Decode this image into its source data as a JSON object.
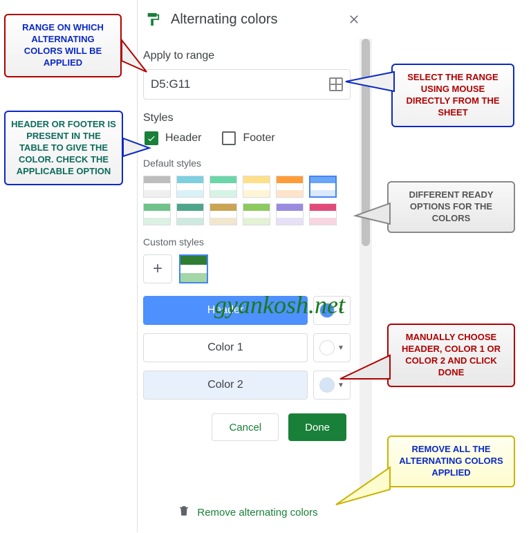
{
  "panel": {
    "title": "Alternating colors",
    "apply_label": "Apply to range",
    "range_value": "D5:G11",
    "styles_label": "Styles",
    "header_label": "Header",
    "footer_label": "Footer",
    "header_checked": true,
    "footer_checked": false,
    "default_styles_label": "Default styles",
    "custom_styles_label": "Custom styles",
    "add_symbol": "+",
    "color_rows": {
      "header": "Header",
      "color1": "Color 1",
      "color2": "Color 2"
    },
    "color_values": {
      "header": "#4d90fe",
      "color1": "#ffffff",
      "color2": "#d6e4f7"
    },
    "buttons": {
      "cancel": "Cancel",
      "done": "Done"
    },
    "remove_label": "Remove alternating colors"
  },
  "default_palettes": [
    {
      "h": "#bdbdbd",
      "a": "#ffffff",
      "b": "#efefef",
      "selected": false
    },
    {
      "h": "#7ecfe0",
      "a": "#ffffff",
      "b": "#d9f2f7",
      "selected": false
    },
    {
      "h": "#6bd6a9",
      "a": "#ffffff",
      "b": "#d7f3e6",
      "selected": false
    },
    {
      "h": "#ffe08a",
      "a": "#ffffff",
      "b": "#fff5d6",
      "selected": false
    },
    {
      "h": "#ff9c3a",
      "a": "#ffffff",
      "b": "#ffe4c9",
      "selected": false
    },
    {
      "h": "#6aa6f7",
      "a": "#ffffff",
      "b": "#dbe9fd",
      "selected": true
    },
    {
      "h": "#6ec28a",
      "a": "#ffffff",
      "b": "#dcf1e3",
      "selected": false
    },
    {
      "h": "#4da58a",
      "a": "#ffffff",
      "b": "#cfe8e0",
      "selected": false
    },
    {
      "h": "#caa452",
      "a": "#ffffff",
      "b": "#f1e7cf",
      "selected": false
    },
    {
      "h": "#8cc95f",
      "a": "#ffffff",
      "b": "#e3f2d5",
      "selected": false
    },
    {
      "h": "#9a8be0",
      "a": "#ffffff",
      "b": "#e6e1f6",
      "selected": false
    },
    {
      "h": "#e24a79",
      "a": "#ffffff",
      "b": "#f8d6e1",
      "selected": false
    }
  ],
  "custom_palette": {
    "h": "#2e7d32",
    "a": "#ffffff",
    "b": "#a5d6a7"
  },
  "watermark": "gyankosh.net",
  "callouts": {
    "range": "RANGE ON WHICH ALTERNATING COLORS WILL BE APPLIED",
    "select": "SELECT THE RANGE USING MOUSE DIRECTLY FROM THE SHEET",
    "header": "HEADER OR FOOTER IS PRESENT IN THE TABLE TO GIVE THE COLOR. CHECK THE APPLICABLE OPTION",
    "ready": "DIFFERENT READY OPTIONS FOR THE COLORS",
    "manual": "MANUALLY CHOOSE HEADER, COLOR 1 OR COLOR 2 AND CLICK DONE",
    "remove": "REMOVE ALL THE ALTERNATING COLORS APPLIED"
  }
}
